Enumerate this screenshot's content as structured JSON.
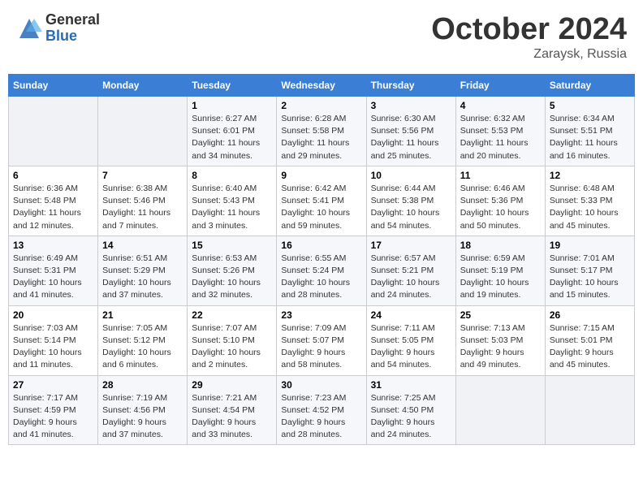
{
  "header": {
    "logo_general": "General",
    "logo_blue": "Blue",
    "month_title": "October 2024",
    "location": "Zaraysk, Russia"
  },
  "days_of_week": [
    "Sunday",
    "Monday",
    "Tuesday",
    "Wednesday",
    "Thursday",
    "Friday",
    "Saturday"
  ],
  "weeks": [
    {
      "days": [
        {
          "num": "",
          "info": ""
        },
        {
          "num": "",
          "info": ""
        },
        {
          "num": "1",
          "info": "Sunrise: 6:27 AM\nSunset: 6:01 PM\nDaylight: 11 hours\nand 34 minutes."
        },
        {
          "num": "2",
          "info": "Sunrise: 6:28 AM\nSunset: 5:58 PM\nDaylight: 11 hours\nand 29 minutes."
        },
        {
          "num": "3",
          "info": "Sunrise: 6:30 AM\nSunset: 5:56 PM\nDaylight: 11 hours\nand 25 minutes."
        },
        {
          "num": "4",
          "info": "Sunrise: 6:32 AM\nSunset: 5:53 PM\nDaylight: 11 hours\nand 20 minutes."
        },
        {
          "num": "5",
          "info": "Sunrise: 6:34 AM\nSunset: 5:51 PM\nDaylight: 11 hours\nand 16 minutes."
        }
      ]
    },
    {
      "days": [
        {
          "num": "6",
          "info": "Sunrise: 6:36 AM\nSunset: 5:48 PM\nDaylight: 11 hours\nand 12 minutes."
        },
        {
          "num": "7",
          "info": "Sunrise: 6:38 AM\nSunset: 5:46 PM\nDaylight: 11 hours\nand 7 minutes."
        },
        {
          "num": "8",
          "info": "Sunrise: 6:40 AM\nSunset: 5:43 PM\nDaylight: 11 hours\nand 3 minutes."
        },
        {
          "num": "9",
          "info": "Sunrise: 6:42 AM\nSunset: 5:41 PM\nDaylight: 10 hours\nand 59 minutes."
        },
        {
          "num": "10",
          "info": "Sunrise: 6:44 AM\nSunset: 5:38 PM\nDaylight: 10 hours\nand 54 minutes."
        },
        {
          "num": "11",
          "info": "Sunrise: 6:46 AM\nSunset: 5:36 PM\nDaylight: 10 hours\nand 50 minutes."
        },
        {
          "num": "12",
          "info": "Sunrise: 6:48 AM\nSunset: 5:33 PM\nDaylight: 10 hours\nand 45 minutes."
        }
      ]
    },
    {
      "days": [
        {
          "num": "13",
          "info": "Sunrise: 6:49 AM\nSunset: 5:31 PM\nDaylight: 10 hours\nand 41 minutes."
        },
        {
          "num": "14",
          "info": "Sunrise: 6:51 AM\nSunset: 5:29 PM\nDaylight: 10 hours\nand 37 minutes."
        },
        {
          "num": "15",
          "info": "Sunrise: 6:53 AM\nSunset: 5:26 PM\nDaylight: 10 hours\nand 32 minutes."
        },
        {
          "num": "16",
          "info": "Sunrise: 6:55 AM\nSunset: 5:24 PM\nDaylight: 10 hours\nand 28 minutes."
        },
        {
          "num": "17",
          "info": "Sunrise: 6:57 AM\nSunset: 5:21 PM\nDaylight: 10 hours\nand 24 minutes."
        },
        {
          "num": "18",
          "info": "Sunrise: 6:59 AM\nSunset: 5:19 PM\nDaylight: 10 hours\nand 19 minutes."
        },
        {
          "num": "19",
          "info": "Sunrise: 7:01 AM\nSunset: 5:17 PM\nDaylight: 10 hours\nand 15 minutes."
        }
      ]
    },
    {
      "days": [
        {
          "num": "20",
          "info": "Sunrise: 7:03 AM\nSunset: 5:14 PM\nDaylight: 10 hours\nand 11 minutes."
        },
        {
          "num": "21",
          "info": "Sunrise: 7:05 AM\nSunset: 5:12 PM\nDaylight: 10 hours\nand 6 minutes."
        },
        {
          "num": "22",
          "info": "Sunrise: 7:07 AM\nSunset: 5:10 PM\nDaylight: 10 hours\nand 2 minutes."
        },
        {
          "num": "23",
          "info": "Sunrise: 7:09 AM\nSunset: 5:07 PM\nDaylight: 9 hours\nand 58 minutes."
        },
        {
          "num": "24",
          "info": "Sunrise: 7:11 AM\nSunset: 5:05 PM\nDaylight: 9 hours\nand 54 minutes."
        },
        {
          "num": "25",
          "info": "Sunrise: 7:13 AM\nSunset: 5:03 PM\nDaylight: 9 hours\nand 49 minutes."
        },
        {
          "num": "26",
          "info": "Sunrise: 7:15 AM\nSunset: 5:01 PM\nDaylight: 9 hours\nand 45 minutes."
        }
      ]
    },
    {
      "days": [
        {
          "num": "27",
          "info": "Sunrise: 7:17 AM\nSunset: 4:59 PM\nDaylight: 9 hours\nand 41 minutes."
        },
        {
          "num": "28",
          "info": "Sunrise: 7:19 AM\nSunset: 4:56 PM\nDaylight: 9 hours\nand 37 minutes."
        },
        {
          "num": "29",
          "info": "Sunrise: 7:21 AM\nSunset: 4:54 PM\nDaylight: 9 hours\nand 33 minutes."
        },
        {
          "num": "30",
          "info": "Sunrise: 7:23 AM\nSunset: 4:52 PM\nDaylight: 9 hours\nand 28 minutes."
        },
        {
          "num": "31",
          "info": "Sunrise: 7:25 AM\nSunset: 4:50 PM\nDaylight: 9 hours\nand 24 minutes."
        },
        {
          "num": "",
          "info": ""
        },
        {
          "num": "",
          "info": ""
        }
      ]
    }
  ]
}
